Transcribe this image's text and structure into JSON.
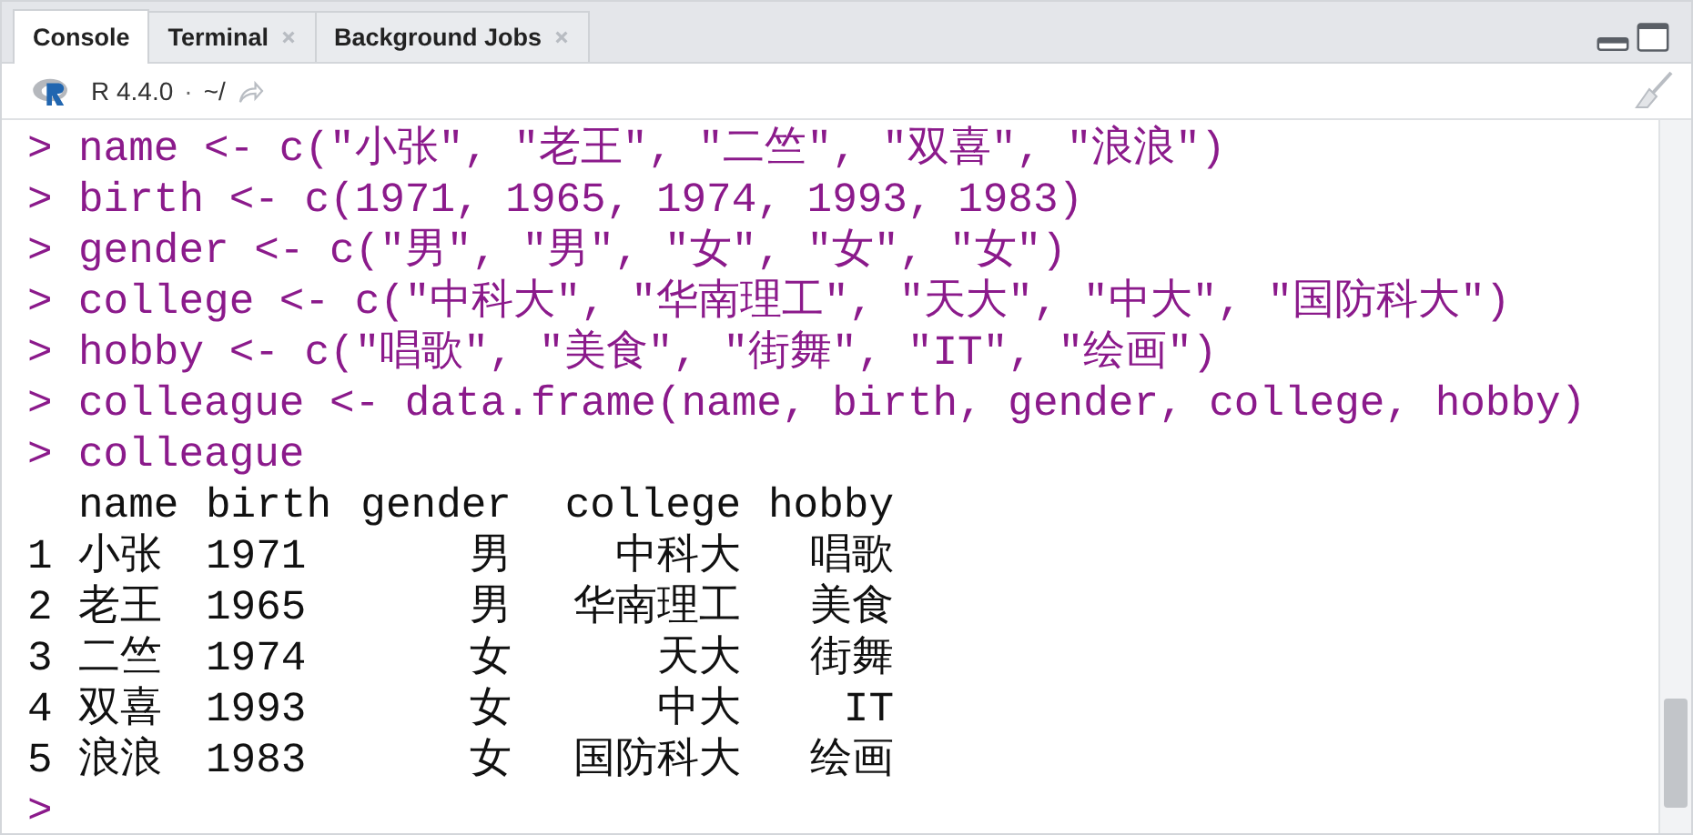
{
  "tabs": [
    {
      "label": "Console",
      "selected": true,
      "closable": false
    },
    {
      "label": "Terminal",
      "selected": false,
      "closable": true
    },
    {
      "label": "Background Jobs",
      "selected": false,
      "closable": true
    }
  ],
  "toolbar": {
    "version": "R 4.4.0",
    "separator": "·",
    "path": "~/"
  },
  "console": {
    "commands": [
      {
        "prompt": ">",
        "code": "name <- c(\"小张\", \"老王\", \"二竺\", \"双喜\", \"浪浪\")"
      },
      {
        "prompt": ">",
        "code": "birth <- c(1971, 1965, 1974, 1993, 1983)"
      },
      {
        "prompt": ">",
        "code": "gender <- c(\"男\", \"男\", \"女\", \"女\", \"女\")"
      },
      {
        "prompt": ">",
        "code": "college <- c(\"中科大\", \"华南理工\", \"天大\", \"中大\", \"国防科大\")"
      },
      {
        "prompt": ">",
        "code": "hobby <- c(\"唱歌\", \"美食\", \"街舞\", \"IT\", \"绘画\")"
      },
      {
        "prompt": ">",
        "code": "colleague <- data.frame(name, birth, gender, college, hobby)"
      },
      {
        "prompt": ">",
        "code": "colleague"
      }
    ],
    "table": {
      "columns": [
        "name",
        "birth",
        "gender",
        "college",
        "hobby"
      ],
      "rows": [
        {
          "index": "1",
          "cells": [
            "小张",
            "1971",
            "男",
            "中科大",
            "唱歌"
          ]
        },
        {
          "index": "2",
          "cells": [
            "老王",
            "1965",
            "男",
            "华南理工",
            "美食"
          ]
        },
        {
          "index": "3",
          "cells": [
            "二竺",
            "1974",
            "女",
            "天大",
            "街舞"
          ]
        },
        {
          "index": "4",
          "cells": [
            "双喜",
            "1993",
            "女",
            "中大",
            "IT"
          ]
        },
        {
          "index": "5",
          "cells": [
            "浪浪",
            "1983",
            "女",
            "国防科大",
            "绘画"
          ]
        }
      ]
    },
    "input_prompt": ">"
  }
}
